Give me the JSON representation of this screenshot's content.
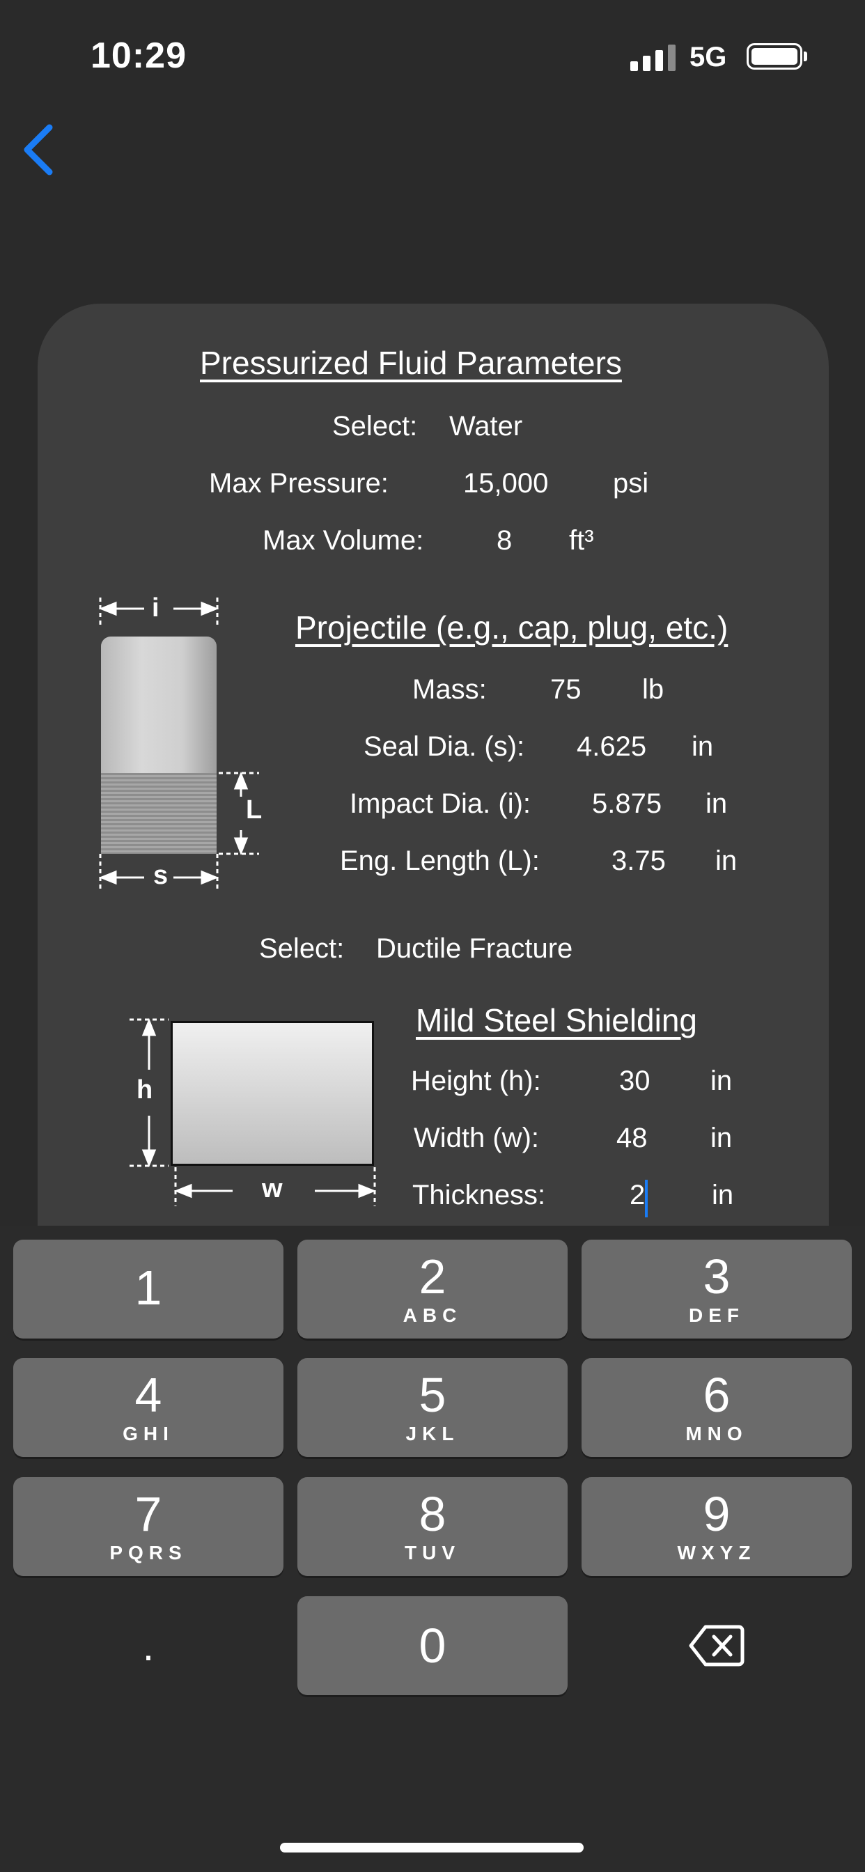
{
  "status_bar": {
    "time": "10:29",
    "network": "5G"
  },
  "params": {
    "title": "Pressurized Fluid Parameters",
    "select_label": "Select:",
    "select_value": "Water",
    "max_pressure_label": "Max Pressure:",
    "max_pressure_value": "15,000",
    "max_pressure_unit": "psi",
    "max_volume_label": "Max Volume:",
    "max_volume_value": "8",
    "max_volume_unit": "ft³"
  },
  "projectile": {
    "title": "Projectile (e.g., cap, plug, etc.)",
    "mass_label": "Mass:",
    "mass_value": "75",
    "mass_unit": "lb",
    "seal_label": "Seal Dia. (s):",
    "seal_value": "4.625",
    "seal_unit": "in",
    "impact_label": "Impact Dia. (i):",
    "impact_value": "5.875",
    "impact_unit": "in",
    "length_label": "Eng. Length (L):",
    "length_value": "3.75",
    "length_unit": "in",
    "diagram_i": "i",
    "diagram_s": "s",
    "diagram_L": "L"
  },
  "failure": {
    "select_label": "Select:",
    "select_value": "Ductile Fracture"
  },
  "shielding": {
    "title": "Mild Steel Shielding",
    "height_label": "Height (h):",
    "height_value": "30",
    "height_unit": "in",
    "width_label": "Width (w):",
    "width_value": "48",
    "width_unit": "in",
    "thickness_label": "Thickness:",
    "thickness_value": "2",
    "thickness_unit": "in",
    "diagram_h": "h",
    "diagram_w": "w"
  },
  "keypad": {
    "keys": [
      {
        "digit": "1",
        "letters": ""
      },
      {
        "digit": "2",
        "letters": "ABC"
      },
      {
        "digit": "3",
        "letters": "DEF"
      },
      {
        "digit": "4",
        "letters": "GHI"
      },
      {
        "digit": "5",
        "letters": "JKL"
      },
      {
        "digit": "6",
        "letters": "MNO"
      },
      {
        "digit": "7",
        "letters": "PQRS"
      },
      {
        "digit": "8",
        "letters": "TUV"
      },
      {
        "digit": "9",
        "letters": "WXYZ"
      },
      {
        "digit": "0",
        "letters": ""
      }
    ],
    "decimal": "."
  }
}
